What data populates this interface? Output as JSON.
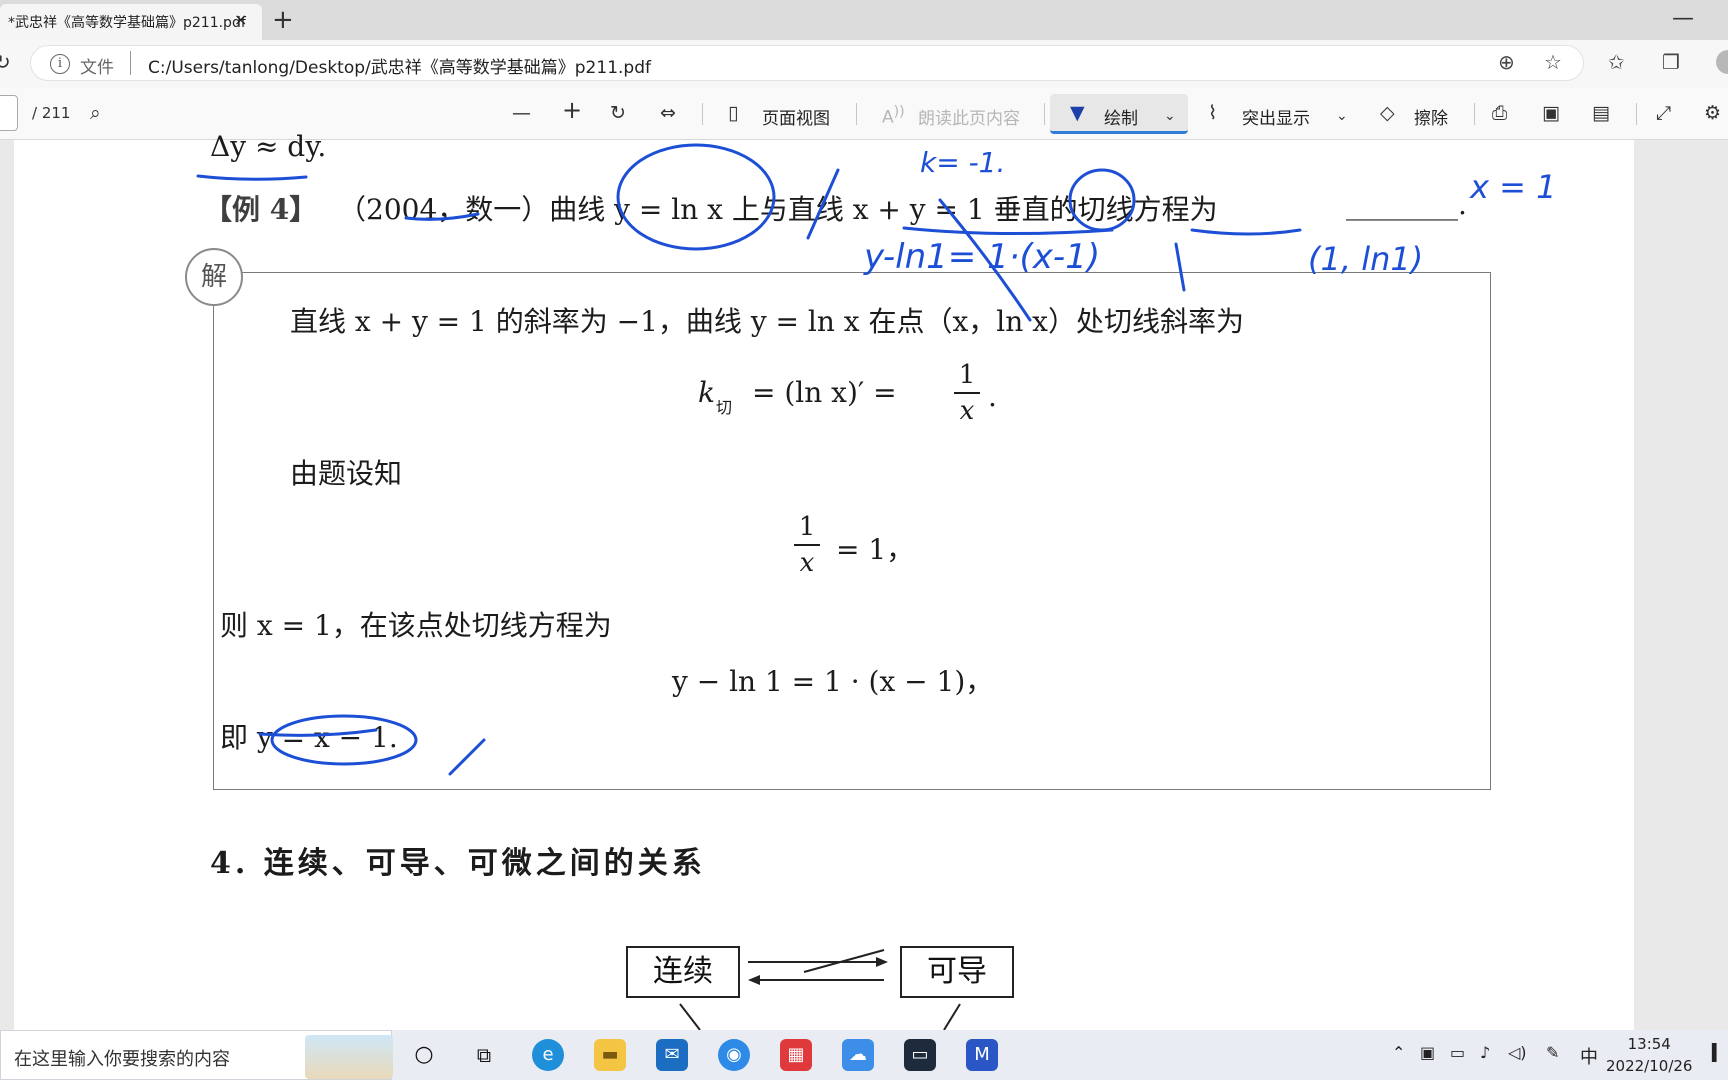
{
  "browser": {
    "tab_title": "*武忠祥《高等数学基础篇》p211.pdf",
    "tab_close": "×",
    "new_tab": "+",
    "minimize": "—",
    "back": "↻",
    "file_label": "文件",
    "url": "C:/Users/tanlong/Desktop/武忠祥《高等数学基础篇》p211.pdf"
  },
  "pdf_toolbar": {
    "page_total": "/ 211",
    "page_view": "页面视图",
    "read_aloud": "朗读此页内容",
    "draw": "绘制",
    "highlight": "突出显示",
    "erase": "擦除"
  },
  "document": {
    "top_formula": "Δy ≈ dy.",
    "example_tag": "【例 4】",
    "example_text": "（2004，数一）曲线 y = ln x 上与直线 x + y = 1 垂直的切线方程为",
    "blank": "________.",
    "solution_badge": "解",
    "sol_line1": "直线 x + y = 1 的斜率为 −1，曲线 y = ln x 在点（x，ln x）处切线斜率为",
    "k_formula_lhs": "k",
    "k_formula_sub": "切",
    "k_formula_mid": "= (ln x)′ =",
    "k_num": "1",
    "k_den": "x",
    "k_end": ".",
    "by_given": "由题设知",
    "eq_num": "1",
    "eq_den": "x",
    "eq_rest": "= 1，",
    "then_line": "则 x = 1，在该点处切线方程为",
    "tangent_eq": "y − ln 1 = 1 · (x − 1)，",
    "result": "即 y = x − 1.",
    "section_title": "4. 连续、可导、可微之间的关系",
    "flow_continuous": "连续",
    "flow_differentiable": "可导"
  },
  "handwriting": {
    "k_note": "k= -1.",
    "x_note": "x = 1",
    "tangent_note": "y-ln1= 1·(x-1)",
    "point_note": "(1, ln1)"
  },
  "taskbar": {
    "search_placeholder": "在这里输入你要搜索的内容",
    "ime": "中",
    "time": "13:54",
    "date": "2022/10/26"
  },
  "colors": {
    "ink_blue": "#1d4fd6",
    "accent": "#2f7bd8"
  }
}
